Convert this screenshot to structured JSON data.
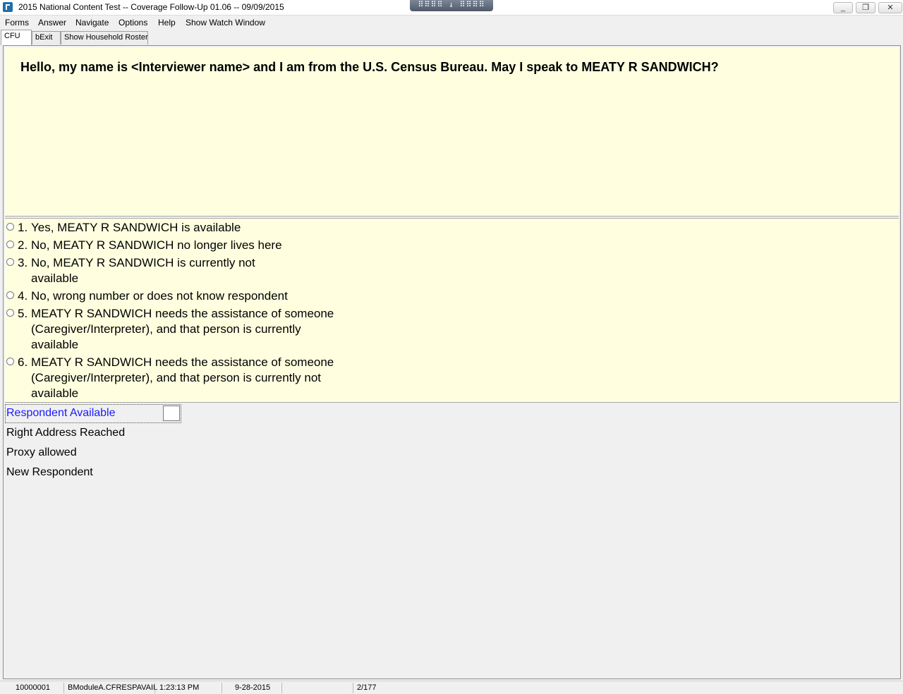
{
  "window": {
    "title": "2015 National Content Test -- Coverage Follow-Up 01.06 -- 09/09/2015",
    "remote_bar": "⠿⠿⠿⠿ ↓ ⠿⠿⠿⠿",
    "minimize": "_",
    "restore": "❐",
    "close": "✕"
  },
  "menu": {
    "forms": "Forms",
    "answer": "Answer",
    "navigate": "Navigate",
    "options": "Options",
    "help": "Help",
    "watch": "Show Watch Window"
  },
  "tabs": {
    "cfu": "CFU",
    "bexit": "bExit",
    "roster": "Show Household Roster"
  },
  "question": {
    "text": "Hello, my name is <Interviewer name> and I am from the U.S. Census Bureau. May I speak to MEATY R SANDWICH?"
  },
  "answers": [
    {
      "num": "1.",
      "label": "Yes, MEATY R SANDWICH is available"
    },
    {
      "num": "2.",
      "label": "No, MEATY R SANDWICH no longer lives here"
    },
    {
      "num": "3.",
      "label": "No, MEATY R SANDWICH is currently not available"
    },
    {
      "num": "4.",
      "label": "No, wrong number or does not know respondent"
    },
    {
      "num": "5.",
      "label": "MEATY R SANDWICH needs the assistance of someone (Caregiver/Interpreter), and that person is currently available"
    },
    {
      "num": "6.",
      "label": "MEATY R SANDWICH needs the assistance of someone (Caregiver/Interpreter), and that person is currently not available"
    }
  ],
  "fields": {
    "respondent_available": "Respondent Available",
    "right_address": "Right Address Reached",
    "proxy_allowed": "Proxy allowed",
    "new_respondent": "New Respondent",
    "respondent_available_value": ""
  },
  "status": {
    "case_id": "10000001",
    "field_name": "BModuleA.CFRESPAVAIL",
    "time": "1:23:13 PM",
    "date": "9-28-2015",
    "blank": "",
    "page": "2/177"
  },
  "colors": {
    "panel_bg": "#ffffe0",
    "current_field": "#1a1aff"
  }
}
